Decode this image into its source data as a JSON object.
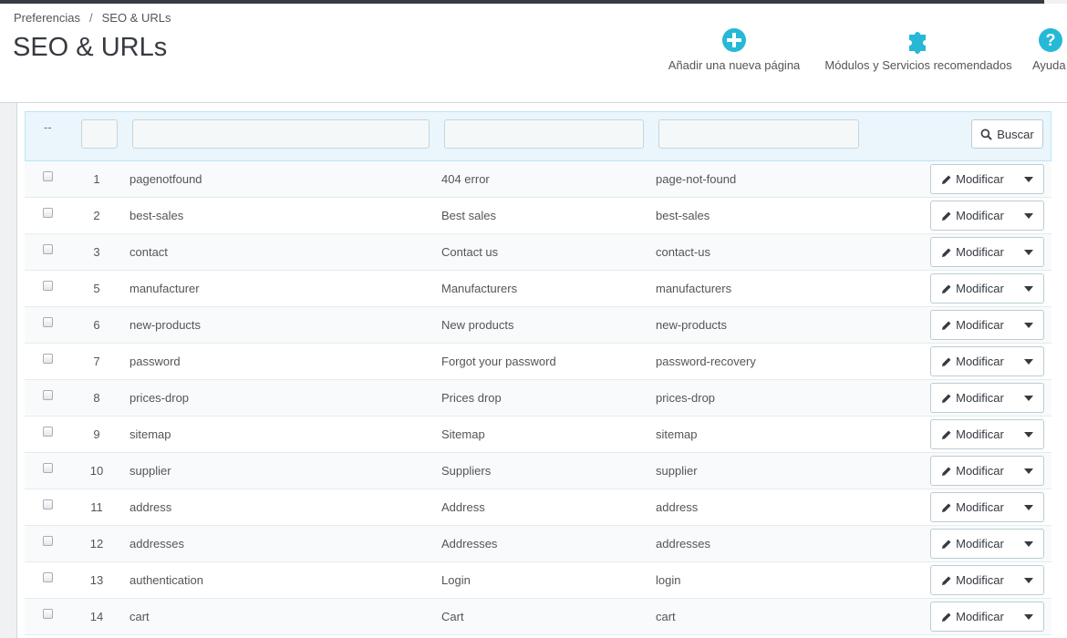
{
  "breadcrumb": {
    "parent": "Preferencias",
    "separator": "/",
    "current": "SEO & URLs"
  },
  "page_title": "SEO & URLs",
  "toolbar": {
    "add_page": "Añadir una nueva página",
    "modules": "Módulos y Servicios recomendados",
    "help": "Ayuda"
  },
  "colors": {
    "accent": "#25b9d7",
    "header_bg": "#ffffff",
    "filter_bg": "#eaf6fc"
  },
  "icons": {
    "add": "plus-circle-icon",
    "modules": "puzzle-icon",
    "help": "question-circle-icon",
    "search": "search-icon",
    "edit": "pencil-icon",
    "caret": "caret-down-icon"
  },
  "filters": {
    "dash": "--",
    "search_label": "Buscar",
    "id": "",
    "page": "",
    "title": "",
    "url": ""
  },
  "actions": {
    "edit_label": "Modificar"
  },
  "rows": [
    {
      "id": "1",
      "page": "pagenotfound",
      "title": "404 error",
      "url": "page-not-found"
    },
    {
      "id": "2",
      "page": "best-sales",
      "title": "Best sales",
      "url": "best-sales"
    },
    {
      "id": "3",
      "page": "contact",
      "title": "Contact us",
      "url": "contact-us"
    },
    {
      "id": "5",
      "page": "manufacturer",
      "title": "Manufacturers",
      "url": "manufacturers"
    },
    {
      "id": "6",
      "page": "new-products",
      "title": "New products",
      "url": "new-products"
    },
    {
      "id": "7",
      "page": "password",
      "title": "Forgot your password",
      "url": "password-recovery"
    },
    {
      "id": "8",
      "page": "prices-drop",
      "title": "Prices drop",
      "url": "prices-drop"
    },
    {
      "id": "9",
      "page": "sitemap",
      "title": "Sitemap",
      "url": "sitemap"
    },
    {
      "id": "10",
      "page": "supplier",
      "title": "Suppliers",
      "url": "supplier"
    },
    {
      "id": "11",
      "page": "address",
      "title": "Address",
      "url": "address"
    },
    {
      "id": "12",
      "page": "addresses",
      "title": "Addresses",
      "url": "addresses"
    },
    {
      "id": "13",
      "page": "authentication",
      "title": "Login",
      "url": "login"
    },
    {
      "id": "14",
      "page": "cart",
      "title": "Cart",
      "url": "cart"
    }
  ]
}
